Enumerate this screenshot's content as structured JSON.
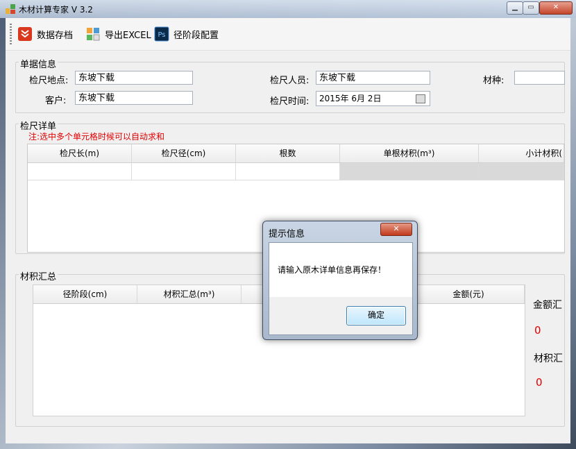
{
  "window": {
    "title": "木材计算专家 V 3.2",
    "min_glyph": "▁",
    "max_glyph": "▭",
    "close_glyph": "✕"
  },
  "toolbar": {
    "items": [
      {
        "label": "数据存档",
        "icon": "save-archive-icon"
      },
      {
        "label": "导出EXCEL",
        "icon": "excel-export-icon"
      },
      {
        "label": "径阶段配置",
        "icon": "ps-config-icon",
        "icon_text": "Ps"
      }
    ]
  },
  "order_info": {
    "title": "单据信息",
    "location_label": "检尺地点:",
    "location_value": "东坡下载",
    "inspector_label": "检尺人员:",
    "inspector_value": "东坡下载",
    "species_label": "材种:",
    "species_value": "",
    "customer_label": "客户:",
    "customer_value": "东坡下载",
    "time_label": "检尺时间:",
    "time_value": "2015年 6月 2日"
  },
  "detail": {
    "title": "检尺详单",
    "note": "注:选中多个单元格时候可以自动求和",
    "columns": [
      "检尺长(m)",
      "检尺径(cm)",
      "根数",
      "单根材积(m³)",
      "小计材积("
    ]
  },
  "summary": {
    "title": "材积汇总",
    "columns": [
      "径阶段(cm)",
      "材积汇总(m³)",
      "",
      "金额(元)"
    ],
    "amount_label": "金额汇",
    "amount_value": "0",
    "volume_label": "材积汇",
    "volume_value": "0"
  },
  "dialog": {
    "title": "提示信息",
    "close_glyph": "✕",
    "message": "请输入原木详单信息再保存！",
    "ok_label": "确定"
  },
  "colors": {
    "alert_red": "#e00000",
    "button_blue": "#3c7fb1"
  }
}
